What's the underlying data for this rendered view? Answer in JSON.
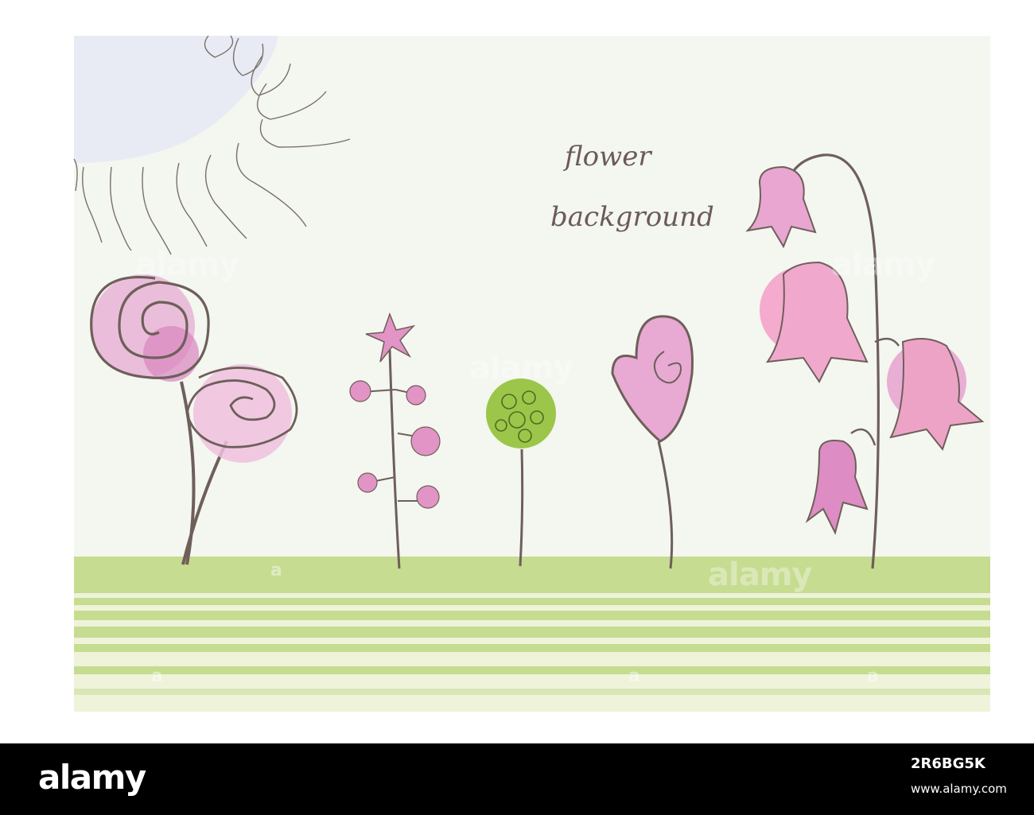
{
  "card": {
    "title_line1": "flower",
    "title_line2": "background"
  },
  "colors": {
    "card_bg": "#f4f6f0",
    "sun_fill": "#e9ebf4",
    "stem": "#6e5f5a",
    "pink_light": "#e8b4d6",
    "pink_mid": "#e294c6",
    "pink_bell": "#eda3c6",
    "green_blob": "#9bc64a",
    "ground_green": "#c6dc90",
    "ground_light": "#eef3da"
  },
  "watermark": {
    "text": "alamy",
    "mark": "a"
  },
  "footer": {
    "logo": "alamy",
    "image_id": "2R6BG5K",
    "site": "www.alamy.com"
  }
}
